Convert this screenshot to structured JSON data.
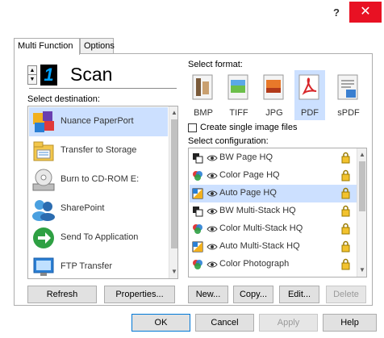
{
  "titlebar": {
    "help_label": "?",
    "close_label": "✕"
  },
  "tabs": [
    {
      "label": "Multi Function"
    },
    {
      "label": "Options"
    }
  ],
  "scan": {
    "number": "1",
    "title": "Scan"
  },
  "destination": {
    "label": "Select destination:",
    "items": [
      {
        "label": "Nuance PaperPort",
        "icon": "paperport-icon",
        "selected": true
      },
      {
        "label": "Transfer to Storage",
        "icon": "storage-icon"
      },
      {
        "label": "Burn to CD-ROM  E:",
        "icon": "cd-rom-icon"
      },
      {
        "label": "SharePoint",
        "icon": "sharepoint-icon"
      },
      {
        "label": "Send To Application",
        "icon": "send-to-application-icon"
      },
      {
        "label": "FTP Transfer",
        "icon": "ftp-transfer-icon"
      }
    ],
    "refresh_label": "Refresh",
    "properties_label": "Properties..."
  },
  "format": {
    "label": "Select format:",
    "items": [
      {
        "label": "BMP",
        "icon": "bmp-icon"
      },
      {
        "label": "TIFF",
        "icon": "tiff-icon"
      },
      {
        "label": "JPG",
        "icon": "jpg-icon"
      },
      {
        "label": "PDF",
        "icon": "pdf-icon",
        "selected": true
      },
      {
        "label": "sPDF",
        "icon": "spdf-icon"
      }
    ],
    "single_image_label": "Create single image files"
  },
  "configuration": {
    "label": "Select configuration:",
    "items": [
      {
        "label": "BW Page HQ",
        "icon": "bw-scan-icon"
      },
      {
        "label": "Color Page HQ",
        "icon": "color-scan-icon"
      },
      {
        "label": "Auto Page HQ",
        "icon": "auto-scan-icon",
        "selected": true
      },
      {
        "label": "BW Multi-Stack HQ",
        "icon": "bw-scan-icon"
      },
      {
        "label": "Color Multi-Stack HQ",
        "icon": "color-scan-icon"
      },
      {
        "label": "Auto Multi-Stack HQ",
        "icon": "auto-scan-icon"
      },
      {
        "label": "Color Photograph",
        "icon": "color-scan-icon"
      }
    ],
    "new_label": "New...",
    "copy_label": "Copy...",
    "edit_label": "Edit...",
    "delete_label": "Delete"
  },
  "footer": {
    "ok_label": "OK",
    "cancel_label": "Cancel",
    "apply_label": "Apply",
    "help_label": "Help"
  },
  "colors": {
    "selection": "#cce0ff",
    "close_button": "#e81123",
    "scan_number": "#00a2ff"
  }
}
